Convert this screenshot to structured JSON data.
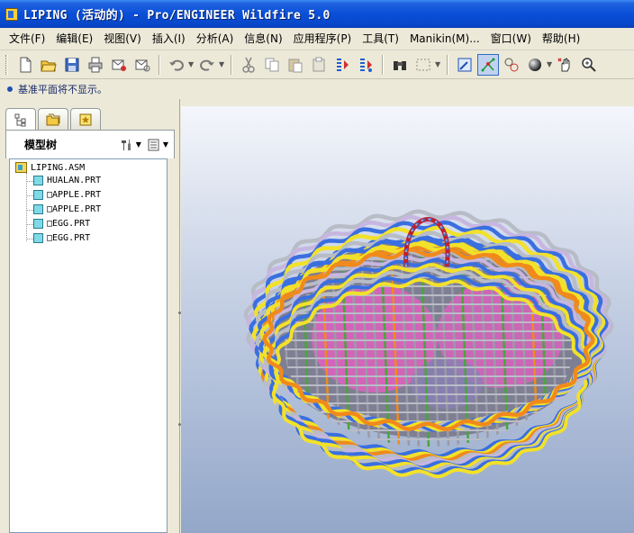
{
  "window": {
    "title": "LIPING (活动的) - Pro/ENGINEER Wildfire 5.0"
  },
  "menu": [
    {
      "label": "文件(F)"
    },
    {
      "label": "编辑(E)"
    },
    {
      "label": "视图(V)"
    },
    {
      "label": "插入(I)"
    },
    {
      "label": "分析(A)"
    },
    {
      "label": "信息(N)"
    },
    {
      "label": "应用程序(P)"
    },
    {
      "label": "工具(T)"
    },
    {
      "label": "Manikin(M)..."
    },
    {
      "label": "窗口(W)"
    },
    {
      "label": "帮助(H)"
    }
  ],
  "toolbar": {
    "buttons": [
      "new-file",
      "open-folder",
      "save",
      "print",
      "send-mail",
      "email-attach",
      "undo",
      "redo",
      "cut",
      "copy",
      "paste",
      "paste-special",
      "regenerate",
      "regenerate-manager",
      "find",
      "select-box",
      "repaint",
      "spin-center",
      "orient",
      "shading-sphere",
      "dynamic-orient",
      "zoom"
    ]
  },
  "message": {
    "text": "基准平面将不显示。"
  },
  "panel": {
    "tabs": [
      "model-tree-tab",
      "folder-browser-tab",
      "favorites-tab"
    ],
    "title": "模型树"
  },
  "tree": {
    "root": "LIPING.ASM",
    "children": [
      {
        "label": "HUALAN.PRT"
      },
      {
        "label": "□APPLE.PRT"
      },
      {
        "label": "□APPLE.PRT"
      },
      {
        "label": "□EGG.PRT"
      },
      {
        "label": "□EGG.PRT"
      }
    ]
  },
  "colors": {
    "titlebar": "#0a4fd8",
    "ui_background": "#ece9d8",
    "weave_yellow": "#f2e12a",
    "weave_orange": "#f08a1c",
    "weave_blue": "#3a6fe0",
    "weave_silver": "#b8bcc6",
    "weave_lilac": "#c7b6e0",
    "grid_gray": "#9a9aa6",
    "grid_green": "#4aa53a",
    "fruit_pink": "#e060c0",
    "handle_red": "#c21e2a"
  }
}
